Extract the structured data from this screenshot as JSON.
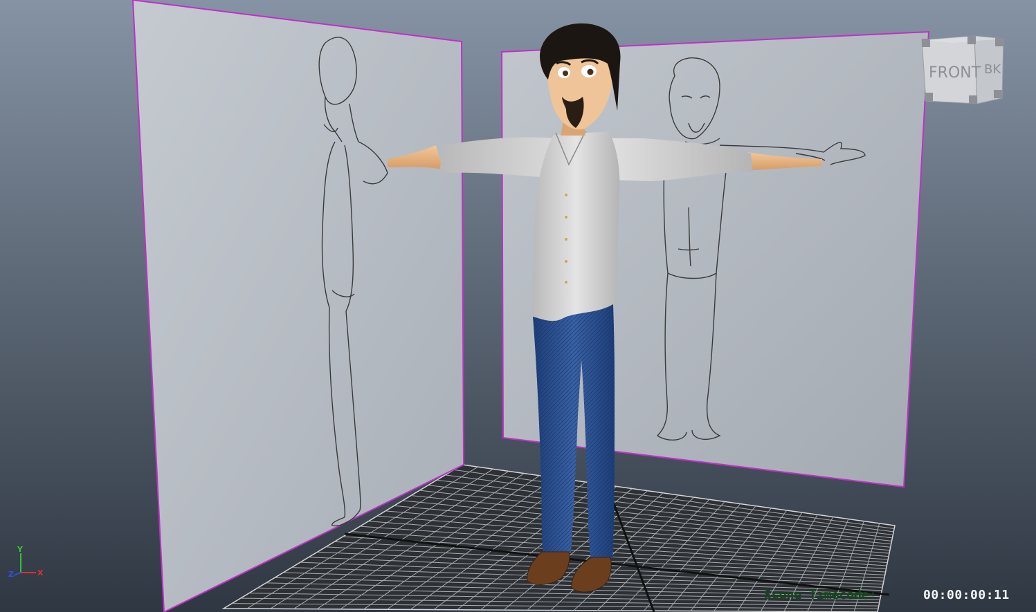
{
  "viewport": {
    "name": "perspective-viewport",
    "colors": {
      "background_top": "#8593a4",
      "background_bottom": "#2f3742",
      "image_plane": "#b6bcc4",
      "image_plane_border": "#c030c8",
      "grid_line": "#a9acaf",
      "grid_bg": "#2e3236",
      "hud_label": "#0f4a18",
      "hud_value": "#f4f4f4"
    }
  },
  "view_cube": {
    "front_label": "FRONT",
    "side_label": "BK"
  },
  "axis_gizmo": {
    "y_label": "Y",
    "z_label": "Z",
    "x_label": "X",
    "x_color": "#e03030",
    "y_color": "#30c830",
    "z_color": "#3050e0"
  },
  "hud": {
    "timecode_label": "Scene Timecode:",
    "timecode_value": "00:00:00:11"
  }
}
